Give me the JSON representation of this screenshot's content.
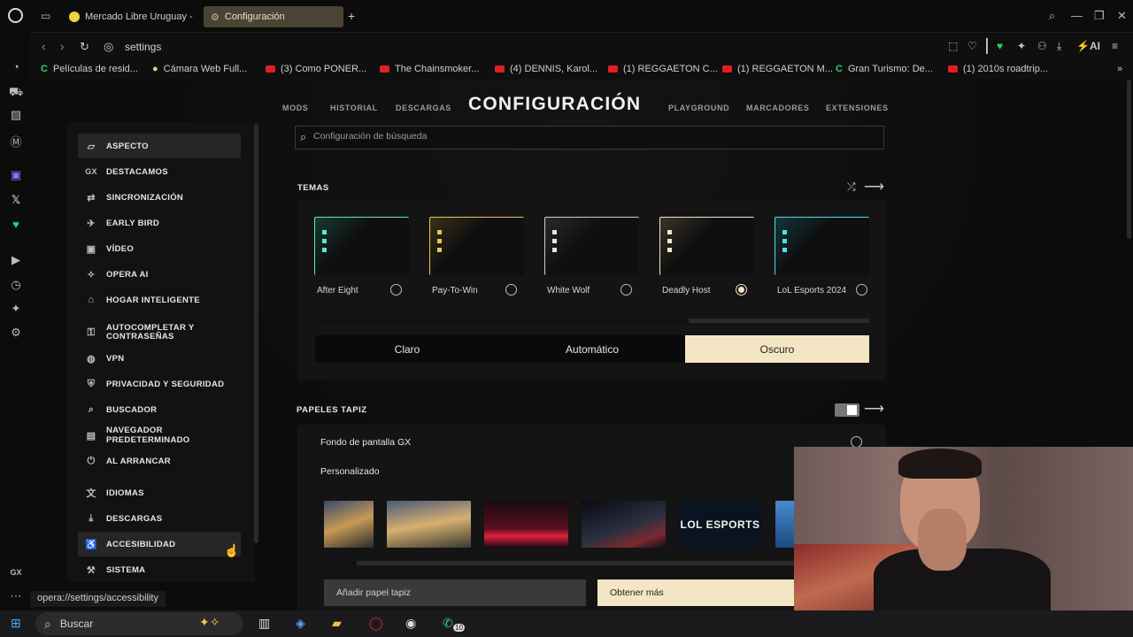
{
  "browser": {
    "tabs": [
      {
        "label": "Mercado Libre Uruguay - E"
      },
      {
        "label": "Configuración"
      }
    ],
    "address": "settings",
    "toolbar_ai_label": "AI"
  },
  "bookmarks": [
    {
      "label": "Películas de resid...",
      "icon": "c-icon"
    },
    {
      "label": "Cámara Web Full...",
      "icon": "bookmark-icon"
    },
    {
      "label": "(3) Como PONER...",
      "icon": "youtube-icon"
    },
    {
      "label": "The Chainsmoker...",
      "icon": "youtube-icon"
    },
    {
      "label": "(4) DENNIS, Karol...",
      "icon": "youtube-icon"
    },
    {
      "label": "(1) REGGAETON C...",
      "icon": "youtube-icon"
    },
    {
      "label": "(1) REGGAETON M...",
      "icon": "youtube-icon"
    },
    {
      "label": "Gran Turismo: De...",
      "icon": "c-icon"
    },
    {
      "label": "(1) 2010s roadtrip...",
      "icon": "youtube-icon"
    }
  ],
  "rail_footer": "GX",
  "settings": {
    "title": "CONFIGURACIÓN",
    "topnav": [
      "MODS",
      "HISTORIAL",
      "DESCARGAS",
      "PLAYGROUND",
      "MARCADORES",
      "EXTENSIONES"
    ],
    "sidebar": [
      {
        "label": "ASPECTO",
        "icon": "brush-icon",
        "selected": true
      },
      {
        "label": "DESTACAMOS",
        "icon": "gx-icon"
      },
      {
        "label": "SINCRONIZACIÓN",
        "icon": "sync-icon"
      },
      {
        "label": "EARLY BIRD",
        "icon": "bird-icon"
      },
      {
        "label": "VÍDEO",
        "icon": "video-icon"
      },
      {
        "label": "OPERA AI",
        "icon": "ai-icon"
      },
      {
        "label": "HOGAR INTELIGENTE",
        "icon": "home-icon"
      },
      {
        "label": "AUTOCOMPLETAR Y CONTRASEÑAS",
        "icon": "key-icon"
      },
      {
        "label": "VPN",
        "icon": "globe-icon"
      },
      {
        "label": "PRIVACIDAD Y SEGURIDAD",
        "icon": "shield-icon"
      },
      {
        "label": "BUSCADOR",
        "icon": "search-icon"
      },
      {
        "label": "NAVEGADOR PREDETERMINADO",
        "icon": "browser-icon"
      },
      {
        "label": "AL ARRANCAR",
        "icon": "power-icon"
      },
      {
        "label": "IDIOMAS",
        "icon": "language-icon"
      },
      {
        "label": "DESCARGAS",
        "icon": "download-icon"
      },
      {
        "label": "ACCESIBILIDAD",
        "icon": "accessibility-icon"
      },
      {
        "label": "SISTEMA",
        "icon": "system-icon"
      }
    ],
    "search_placeholder": "Configuración de búsqueda",
    "themes": {
      "heading": "TEMAS",
      "items": [
        {
          "name": "After Eight",
          "accent": "#5fe6c8",
          "selected": false
        },
        {
          "name": "Pay-To-Win",
          "accent": "#e8c45a",
          "selected": false
        },
        {
          "name": "White Wolf",
          "accent": "#e6e6e6",
          "selected": false
        },
        {
          "name": "Deadly Host",
          "accent": "#f4e6c4",
          "selected": true
        },
        {
          "name": "LoL Esports 2024",
          "accent": "#4fe0e8",
          "selected": false
        }
      ],
      "modes": [
        "Claro",
        "Automático",
        "Oscuro"
      ],
      "active_mode": "Oscuro"
    },
    "wallpapers": {
      "heading": "PAPELES TAPIZ",
      "gx_label": "Fondo de pantalla GX",
      "custom_label": "Personalizado",
      "add_label": "Añadir papel tapiz",
      "get_more_label": "Obtener más",
      "lol_thumb_text": "LOL ESPORTS"
    }
  },
  "status_url": "opera://settings/accessibility",
  "taskbar": {
    "search_label": "Buscar",
    "whatsapp_badge": "10"
  },
  "colors": {
    "accent": "#f4e6c4",
    "background": "#0c0c0d",
    "panel": "#141415"
  }
}
